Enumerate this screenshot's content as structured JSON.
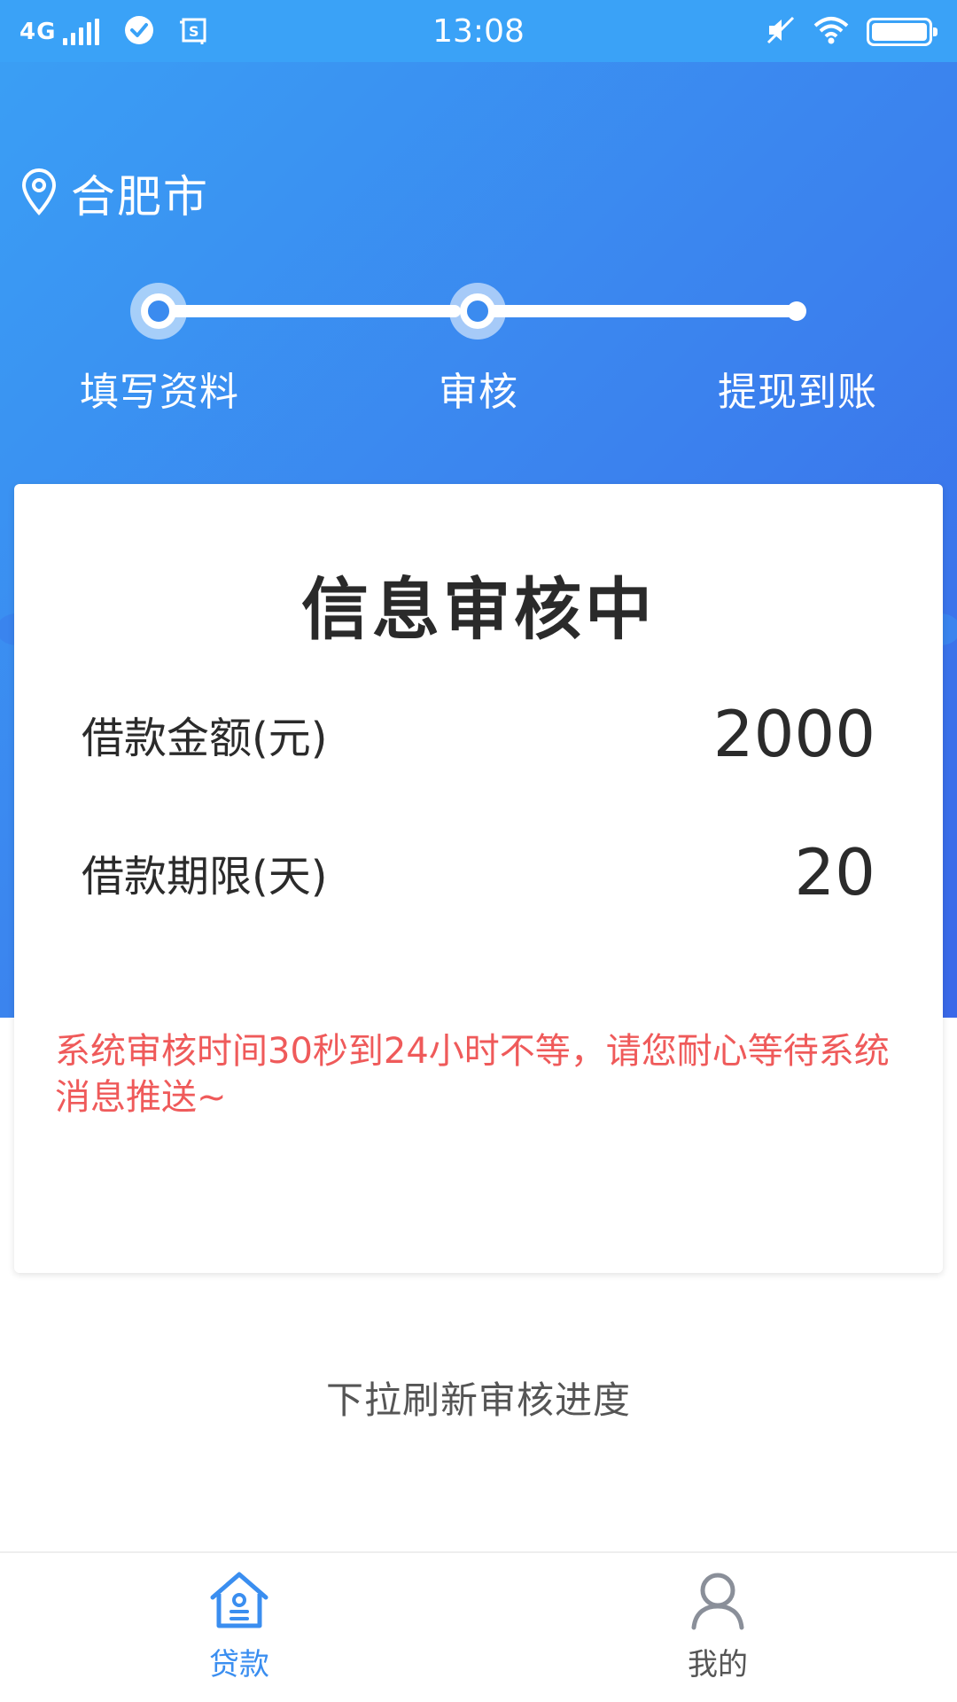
{
  "status_bar": {
    "network": "4G",
    "time": "13:08"
  },
  "location": {
    "city": "合肥市"
  },
  "steps": [
    {
      "label": "填写资料",
      "state": "done"
    },
    {
      "label": "审核",
      "state": "active"
    },
    {
      "label": "提现到账",
      "state": "pending"
    }
  ],
  "card": {
    "title": "信息审核中",
    "rows": [
      {
        "label": "借款金额(元)",
        "value": "2000"
      },
      {
        "label": "借款期限(天)",
        "value": "20"
      }
    ],
    "notice": "系统审核时间30秒到24小时不等，请您耐心等待系统消息推送~"
  },
  "hint": "下拉刷新审核进度",
  "bottom_nav": {
    "items": [
      {
        "label": "贷款",
        "icon": "home-icon",
        "active": true
      },
      {
        "label": "我的",
        "icon": "user-icon",
        "active": false
      }
    ]
  },
  "colors": {
    "primary": "#3b8bef",
    "notice": "#ef5a5a",
    "nav_active": "#3a8ef0",
    "nav_inactive": "#555555"
  }
}
